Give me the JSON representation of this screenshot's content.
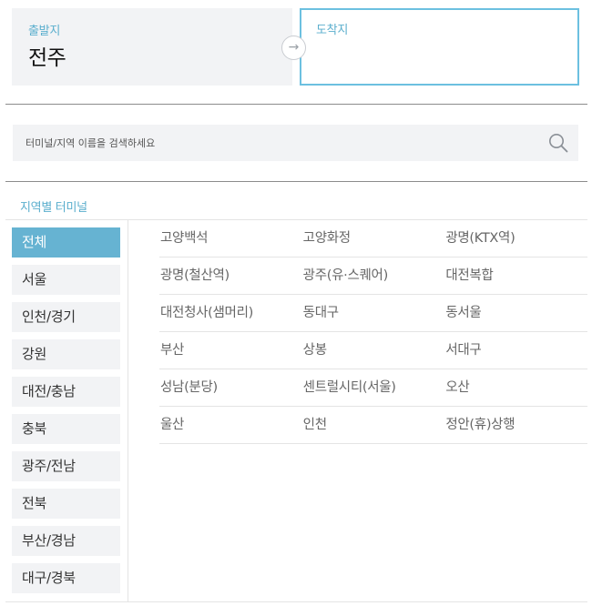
{
  "route": {
    "origin_label": "출발지",
    "origin_value": "전주",
    "swap_icon": "arrow-right-icon",
    "destination_label": "도착지",
    "destination_value": ""
  },
  "search": {
    "placeholder": "터미널/지역 이름을 검색하세요",
    "icon": "search-icon"
  },
  "section_title": "지역별 터미널",
  "regions": [
    {
      "label": "전체",
      "active": true
    },
    {
      "label": "서울"
    },
    {
      "label": "인천/경기"
    },
    {
      "label": "강원"
    },
    {
      "label": "대전/충남"
    },
    {
      "label": "충북"
    },
    {
      "label": "광주/전남"
    },
    {
      "label": "전북"
    },
    {
      "label": "부산/경남"
    },
    {
      "label": "대구/경북"
    }
  ],
  "terminals": [
    [
      "고양백석",
      "고양화정",
      "광명(KTX역)"
    ],
    [
      "광명(철산역)",
      "광주(유·스퀘어)",
      "대전복합"
    ],
    [
      "대전청사(샘머리)",
      "동대구",
      "동서울"
    ],
    [
      "부산",
      "상봉",
      "서대구"
    ],
    [
      "성남(분당)",
      "센트럴시티(서울)",
      "오산"
    ],
    [
      "울산",
      "인천",
      "정안(휴)상행"
    ]
  ],
  "colors": {
    "accent": "#5aaecd",
    "active_region_bg": "#66b3d2",
    "panel_bg": "#f2f3f5",
    "dest_border": "#6cc0e0"
  }
}
